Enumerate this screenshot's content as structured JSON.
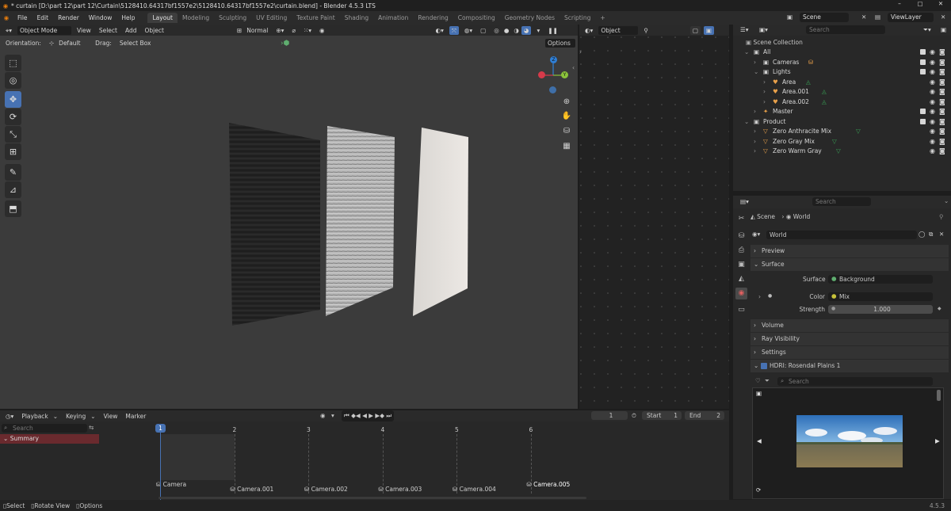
{
  "title_bar": {
    "text": "* curtain [D:\\part 12\\part 12\\Curtain\\5128410.64317bf1557e2\\5128410.64317bf1557e2\\curtain.blend] - Blender 4.5.3 LTS",
    "buttons": [
      "–",
      "▢",
      "✕"
    ]
  },
  "menu": [
    "File",
    "Edit",
    "Render",
    "Window",
    "Help"
  ],
  "workspaces": [
    "Layout",
    "Modeling",
    "Sculpting",
    "UV Editing",
    "Texture Paint",
    "Shading",
    "Animation",
    "Rendering",
    "Compositing",
    "Geometry Nodes",
    "Scripting",
    "+"
  ],
  "active_workspace": "Layout",
  "scene_name": "Scene",
  "view_layer": "ViewLayer",
  "viewport": {
    "mode": "Object Mode",
    "menus": [
      "View",
      "Select",
      "Add",
      "Object"
    ],
    "transform_orientation": "Normal",
    "orientation_label": "Orientation:",
    "orientation_value": "Default",
    "drag_label": "Drag:",
    "drag_value": "Select Box",
    "options": "Options",
    "gizmo": {
      "x": "X",
      "y": "Y",
      "z": "Z"
    }
  },
  "graph_editor": {
    "mode": "Object"
  },
  "outliner": {
    "search_placeholder": "Search",
    "root": "Scene Collection",
    "rows": [
      {
        "label": "All",
        "depth": 1,
        "type": "collection",
        "check": true
      },
      {
        "label": "Cameras",
        "depth": 2,
        "type": "collection",
        "check": true
      },
      {
        "label": "Lights",
        "depth": 2,
        "type": "collection",
        "check": true
      },
      {
        "label": "Area",
        "depth": 3,
        "type": "light",
        "check": false
      },
      {
        "label": "Area.001",
        "depth": 3,
        "type": "light",
        "check": false
      },
      {
        "label": "Area.002",
        "depth": 3,
        "type": "light",
        "check": false
      },
      {
        "label": "Master",
        "depth": 2,
        "type": "armature",
        "check": true
      },
      {
        "label": "Product",
        "depth": 1,
        "type": "collection",
        "check": true
      },
      {
        "label": "Zero Anthracite Mix",
        "depth": 2,
        "type": "mesh",
        "check": false
      },
      {
        "label": "Zero Gray Mix",
        "depth": 2,
        "type": "mesh",
        "check": false
      },
      {
        "label": "Zero Warm Gray",
        "depth": 2,
        "type": "mesh",
        "check": false
      }
    ]
  },
  "properties": {
    "search_placeholder": "Search",
    "breadcrumb": [
      "Scene",
      "World"
    ],
    "world_name": "World",
    "sections": [
      "Preview",
      "Surface",
      "Volume",
      "Ray Visibility",
      "Settings"
    ],
    "surface_label": "Surface",
    "surface_value": "Background",
    "color_label": "Color",
    "color_value": "Mix",
    "strength_label": "Strength",
    "strength_value": "1.000",
    "hdri_title": "HDRI: Rosendal Plains 1",
    "hdri_search": "Search"
  },
  "timeline": {
    "menus": [
      "Playback",
      "Keying",
      "View",
      "Marker"
    ],
    "current_frame": "1",
    "start_label": "Start",
    "start": "1",
    "end_label": "End",
    "end": "2",
    "search_placeholder": "Search",
    "summary": "Summary",
    "frames": [
      "1",
      "2",
      "3",
      "4",
      "5",
      "6"
    ],
    "cameras": [
      "Camera",
      "Camera.001",
      "Camera.002",
      "Camera.003",
      "Camera.004",
      "Camera.005"
    ]
  },
  "status": {
    "items": [
      "Select",
      "Rotate View",
      "Options"
    ],
    "version": "4.5.3"
  },
  "colors": {
    "accent": "#4772b3",
    "orange": "#e87d0d",
    "green": "#38a155"
  }
}
